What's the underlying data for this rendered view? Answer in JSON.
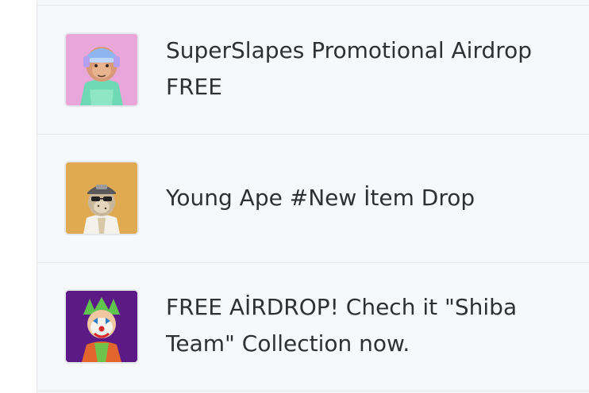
{
  "items": [
    {
      "title": "SuperSlapes Promotional Airdrop FREE",
      "thumb_bg": "#e9a6d8",
      "icon": "ape-helmet-icon"
    },
    {
      "title": "Young Ape #New İtem Drop",
      "thumb_bg": "#e0aa52",
      "icon": "ape-cap-icon"
    },
    {
      "title": "FREE AİRDROP! Chech it \"Shiba Team\" Collection now.",
      "thumb_bg": "#5b1a86",
      "icon": "shiba-clown-icon"
    }
  ],
  "colors": {
    "list_bg": "#f7f8fb",
    "divider": "#e3e5ea",
    "text": "#2e3034"
  }
}
